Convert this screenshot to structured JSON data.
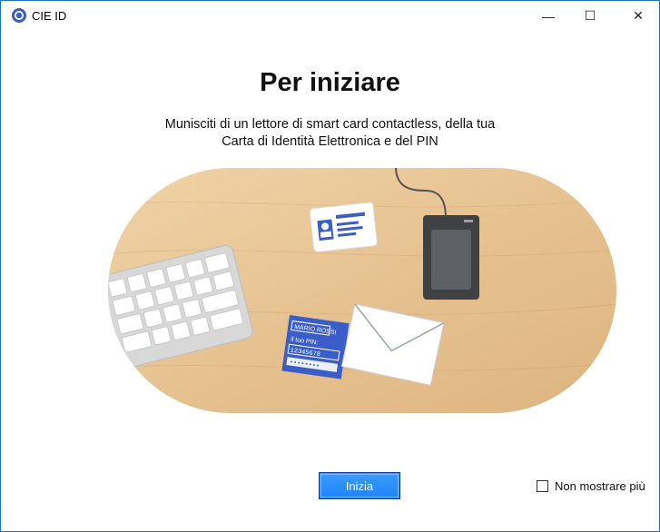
{
  "window": {
    "title": "CIE ID",
    "controls": {
      "minimize": "—",
      "maximize": "☐",
      "close": "✕"
    }
  },
  "main": {
    "heading": "Per iniziare",
    "subtitle_line1": "Munisciti di un lettore di smart card contactless, della tua",
    "subtitle_line2": "Carta di Identità Elettronica e del PIN"
  },
  "illustration": {
    "pin_card_name": "MARIO ROSSI",
    "pin_card_label": "il tuo PIN:",
    "pin_card_digits": "12345678",
    "pin_card_masked": "••••••••",
    "icons": [
      "keyboard-icon",
      "id-card-icon",
      "card-reader-icon",
      "pin-letter-icon",
      "envelope-icon"
    ]
  },
  "footer": {
    "start_label": "Inizia",
    "dont_show_label": "Non mostrare più",
    "dont_show_checked": false
  },
  "colors": {
    "accent": "#1f85f7",
    "table": "#e9c99a",
    "pin_card": "#3a5dc7",
    "reader": "#3f4145",
    "window_border": "#1a73c7"
  }
}
